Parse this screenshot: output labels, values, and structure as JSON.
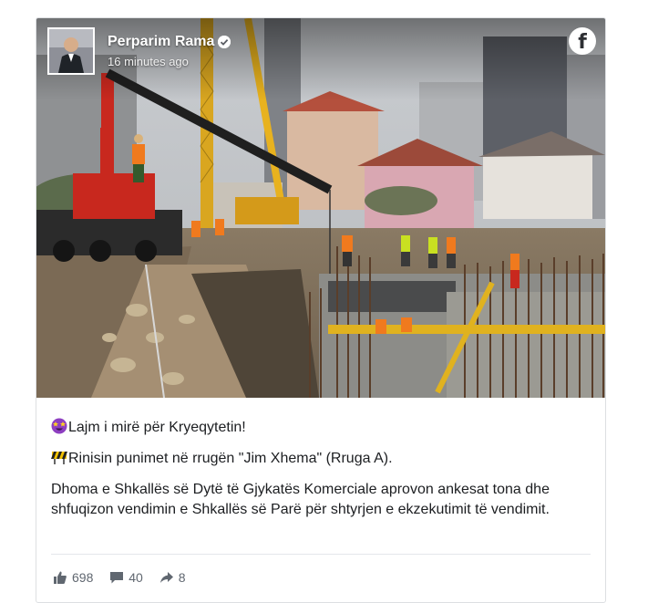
{
  "post": {
    "author": "Perparim Rama",
    "verified": true,
    "time": "16 minutes ago",
    "platform_icon": "facebook-logo-icon",
    "lines": [
      {
        "emoji": "star-struck-icon",
        "text": "Lajm i mirë për Kryeqytetin!"
      },
      {
        "emoji": "construction-icon",
        "text": "Rinisin punimet në rrugën \"Jim Xhema\" (Rruga A)."
      },
      {
        "emoji": "",
        "text": "Dhoma e Shkallës së Dytë të Gjykatës Komerciale aprovon ankesat tona dhe shfuqizon vendimin e Shkallës së Parë për shtyrjen e ekzekutimit të vendimit."
      }
    ],
    "stats": {
      "likes": "698",
      "comments": "40",
      "shares": "8"
    }
  },
  "colors": {
    "text": "#1c1e21",
    "muted": "#606770",
    "border": "#dddfe2",
    "crane_red": "#c8281e",
    "crane_yellow": "#e8b21f"
  }
}
